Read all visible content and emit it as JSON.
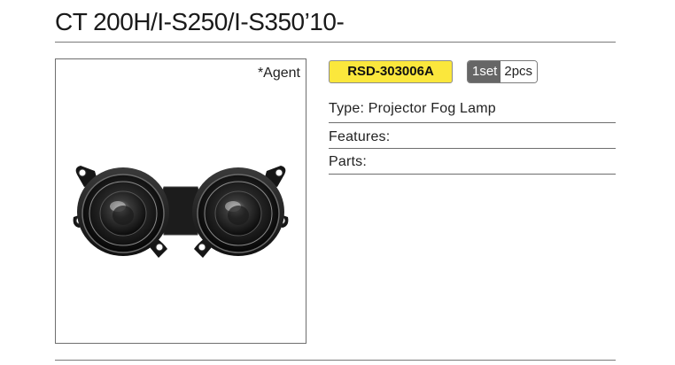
{
  "page": {
    "title": "CT 200H/I-S250/I-S350’10-"
  },
  "product": {
    "agent_note": "*Agent",
    "image_alt": "Projector fog lamp pair",
    "part_number": "RSD-303006A",
    "quantity_set": "1set",
    "quantity_pcs": "2pcs",
    "type_line": "Type: Projector Fog Lamp",
    "features_line": "Features:",
    "parts_line": "Parts:"
  },
  "colors": {
    "badge_background": "#fbe73c",
    "set_background": "#666666"
  }
}
